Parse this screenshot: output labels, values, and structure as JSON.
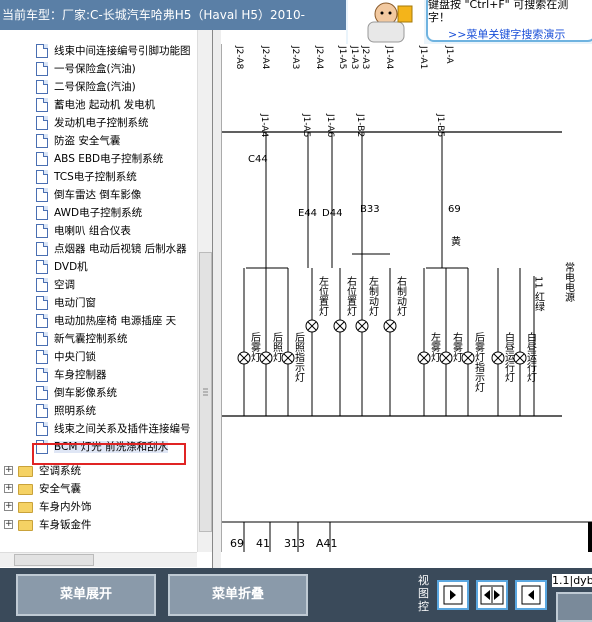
{
  "header": {
    "current_model": "当前车型：厂家:C-长城汽车哈弗H5（Haval H5）2010-"
  },
  "ad": {
    "line1": "键盘按 \"Ctrl+F\" 可搜索在测",
    "line2": "字！",
    "link": ">>菜单关键字搜索演示"
  },
  "tree": {
    "items": [
      {
        "label": "线束中间连接编号引脚功能图",
        "kind": "doc"
      },
      {
        "label": "一号保险盒(汽油)",
        "kind": "doc"
      },
      {
        "label": "二号保险盒(汽油)",
        "kind": "doc"
      },
      {
        "label": "蓄电池 起动机 发电机",
        "kind": "doc"
      },
      {
        "label": "发动机电子控制系统",
        "kind": "doc"
      },
      {
        "label": "防盗 安全气囊",
        "kind": "doc"
      },
      {
        "label": "ABS EBD电子控制系统",
        "kind": "doc"
      },
      {
        "label": "TCS电子控制系统",
        "kind": "doc"
      },
      {
        "label": "倒车雷达 倒车影像",
        "kind": "doc"
      },
      {
        "label": "AWD电子控制系统",
        "kind": "doc"
      },
      {
        "label": "电喇叭 组合仪表",
        "kind": "doc"
      },
      {
        "label": "点烟器 电动后视镜 后制水器",
        "kind": "doc"
      },
      {
        "label": "DVD机",
        "kind": "doc"
      },
      {
        "label": "空调",
        "kind": "doc"
      },
      {
        "label": "电动门窗",
        "kind": "doc"
      },
      {
        "label": "电动加热座椅 电源插座 天",
        "kind": "doc"
      },
      {
        "label": "新气囊控制系统",
        "kind": "doc"
      },
      {
        "label": "中央门锁",
        "kind": "doc"
      },
      {
        "label": "车身控制器",
        "kind": "doc"
      },
      {
        "label": "倒车影像系统",
        "kind": "doc"
      },
      {
        "label": "照明系统",
        "kind": "doc"
      },
      {
        "label": "线束之间关系及插件连接编号",
        "kind": "doc"
      },
      {
        "label": "BCM 灯光 前洗涤和刮水",
        "kind": "doc",
        "selected": true
      }
    ],
    "folders": [
      {
        "label": "空调系统"
      },
      {
        "label": "安全气囊"
      },
      {
        "label": "车身内外饰"
      },
      {
        "label": "车身钣金件"
      }
    ]
  },
  "diagram": {
    "top_connectors": [
      "J2-A8",
      "J2-A4",
      "J2-A3",
      "J2-A4",
      "J1-A5",
      "J1-A3",
      "J2-A3",
      "J1-A4",
      "J1-A1",
      "J1-A"
    ],
    "pins": [
      "J1-A4",
      "J1-A5",
      "J1-A6",
      "J1-B2",
      "J1-B5"
    ],
    "codes": [
      "C44",
      "E44",
      "D44",
      "B33",
      "69"
    ],
    "wire_color": "黄",
    "lamps": [
      "后雾灯",
      "后照灯",
      "后照指示灯",
      "左位置灯",
      "右位置灯",
      "左制动灯",
      "右制动灯",
      "左雾灯",
      "右雾灯",
      "后雾灯指示灯",
      "白昼运行灯",
      "白昼运行灯"
    ],
    "side_text": "常电电源",
    "right_code": "11 红绿",
    "bottom_labels": [
      "69",
      "41",
      "313",
      "A41"
    ]
  },
  "toolbar": {
    "expand_label": "菜单展开",
    "collapse_label": "菜单折叠",
    "view_label": "视图控",
    "zoom_text": "1.1|dyb"
  }
}
